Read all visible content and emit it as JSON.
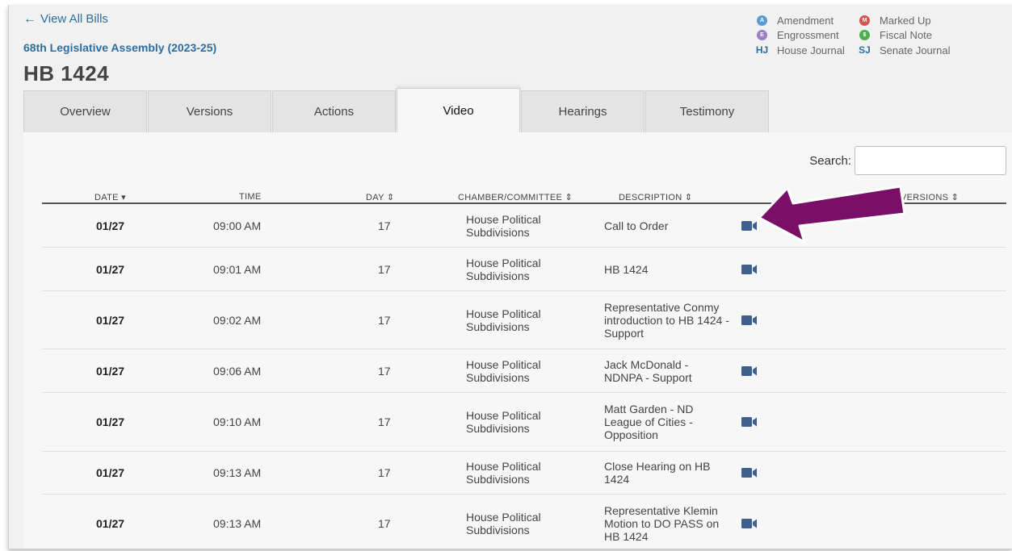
{
  "nav": {
    "back_label": "View All Bills"
  },
  "header": {
    "assembly": "68th Legislative Assembly (2023-25)",
    "bill": "HB 1424"
  },
  "legend": {
    "items": [
      {
        "abbr": "A",
        "label": "Amendment",
        "color": "#5b9bd5"
      },
      {
        "abbr": "M",
        "label": "Marked Up",
        "color": "#d9534f"
      },
      {
        "abbr": "E",
        "label": "Engrossment",
        "color": "#9b7fc9"
      },
      {
        "abbr": "$",
        "label": "Fiscal Note",
        "color": "#4cae4c"
      },
      {
        "abbr": "HJ",
        "label": "House Journal"
      },
      {
        "abbr": "SJ",
        "label": "Senate Journal"
      }
    ]
  },
  "tabs": [
    {
      "label": "Overview",
      "active": false
    },
    {
      "label": "Versions",
      "active": false
    },
    {
      "label": "Actions",
      "active": false
    },
    {
      "label": "Video",
      "active": true
    },
    {
      "label": "Hearings",
      "active": false
    },
    {
      "label": "Testimony",
      "active": false
    }
  ],
  "search": {
    "label": "Search:",
    "value": ""
  },
  "table": {
    "headers": {
      "date": "DATE ▾",
      "time": "TIME",
      "day": "DAY ⇕",
      "chamber": "CHAMBER/COMMITTEE ⇕",
      "description": "DESCRIPTION ⇕",
      "versions": "VERSIONS ⇕"
    },
    "rows": [
      {
        "date": "01/27",
        "time": "09:00 AM",
        "day": "17",
        "chamber": "House Political Subdivisions",
        "description": "Call to Order"
      },
      {
        "date": "01/27",
        "time": "09:01 AM",
        "day": "17",
        "chamber": "House Political Subdivisions",
        "description": "HB 1424"
      },
      {
        "date": "01/27",
        "time": "09:02 AM",
        "day": "17",
        "chamber": "House Political Subdivisions",
        "description": "Representative Conmy introduction to HB 1424 - Support"
      },
      {
        "date": "01/27",
        "time": "09:06 AM",
        "day": "17",
        "chamber": "House Political Subdivisions",
        "description": "Jack McDonald - NDNPA - Support"
      },
      {
        "date": "01/27",
        "time": "09:10 AM",
        "day": "17",
        "chamber": "House Political Subdivisions",
        "description": "Matt Garden - ND League of Cities - Opposition"
      },
      {
        "date": "01/27",
        "time": "09:13 AM",
        "day": "17",
        "chamber": "House Political Subdivisions",
        "description": "Close Hearing on HB 1424"
      },
      {
        "date": "01/27",
        "time": "09:13 AM",
        "day": "17",
        "chamber": "House Political Subdivisions",
        "description": "Representative Klemin Motion to DO PASS on HB 1424"
      }
    ]
  },
  "colors": {
    "link": "#2d6e9e",
    "video_icon": "#3f5f8c",
    "annotation_arrow": "#7a0f68"
  }
}
